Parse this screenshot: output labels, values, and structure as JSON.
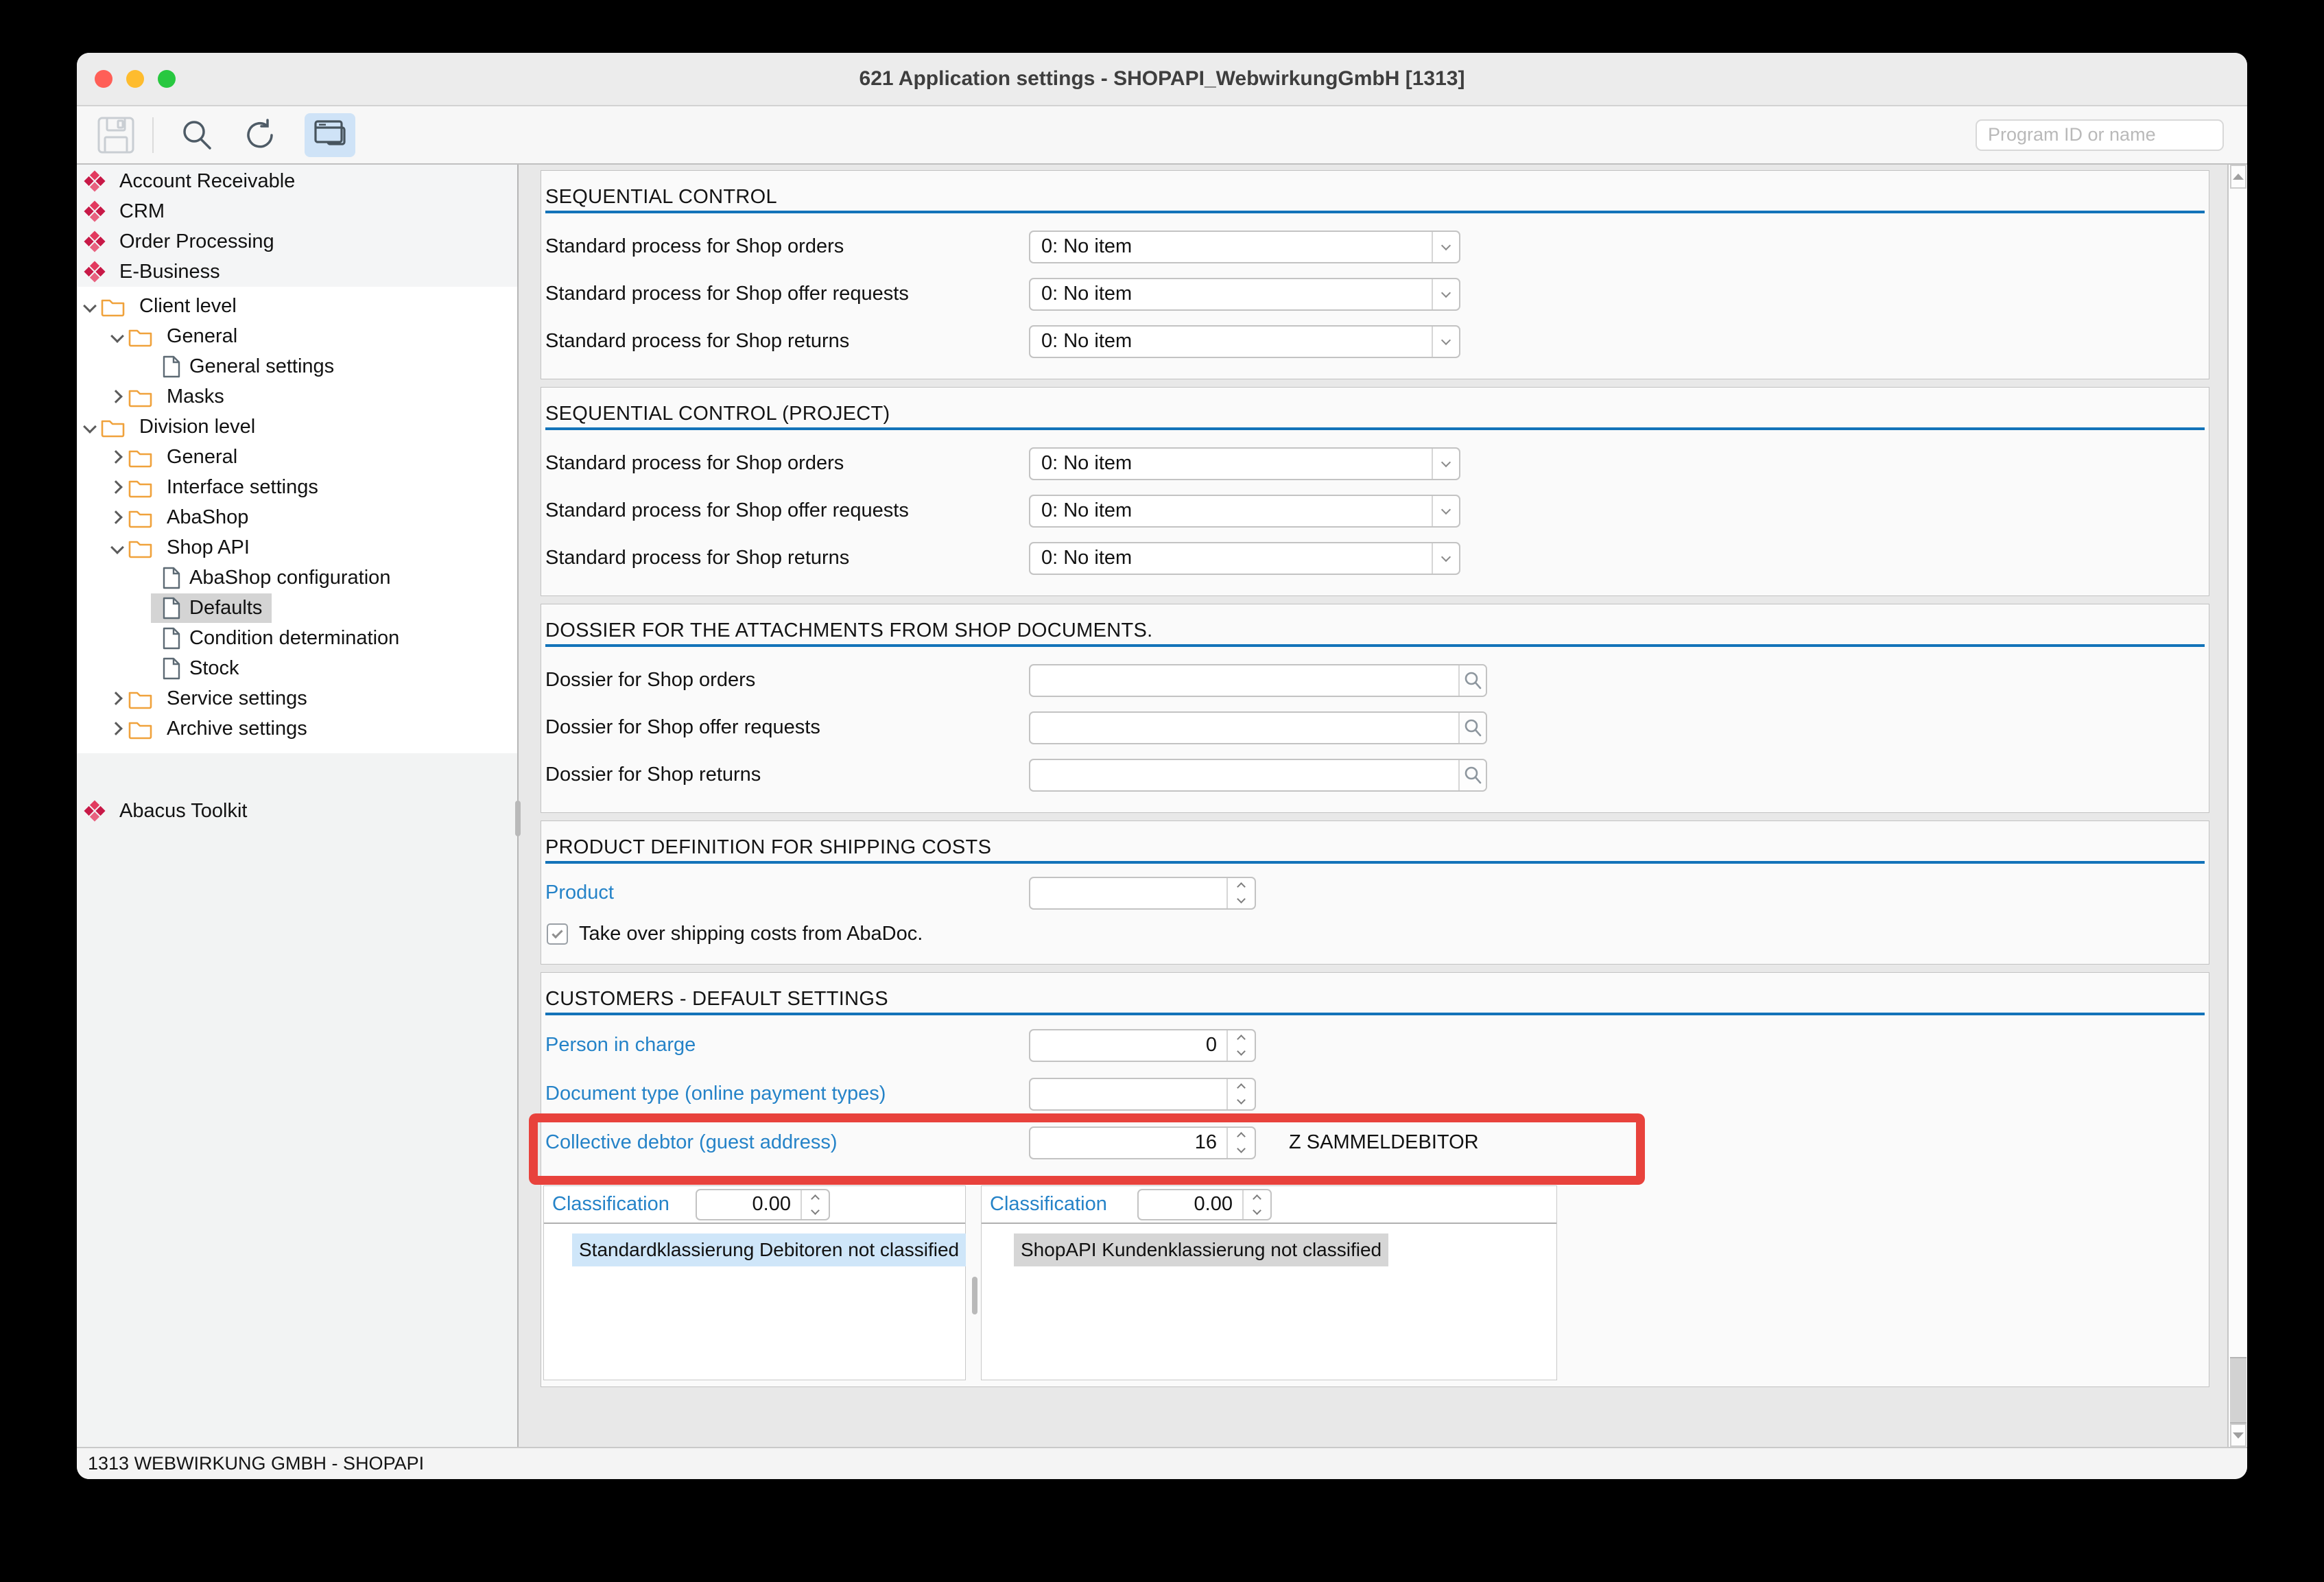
{
  "window": {
    "title": "621 Application settings - SHOPAPI_WebwirkungGmbH [1313]",
    "status_bar": "1313 WEBWIRKUNG GMBH - SHOPAPI"
  },
  "toolbar": {
    "search_placeholder": "Program ID or name",
    "icons": [
      "save-icon",
      "search-icon",
      "refresh-icon",
      "window-icon"
    ],
    "selected_icon": "window-icon",
    "selected_icon_bg": "#cfe3f7"
  },
  "sidebar": {
    "modules": [
      "Account Receivable",
      "CRM",
      "Order Processing",
      "E-Business"
    ],
    "tree": [
      {
        "label": "Client level",
        "level": 1,
        "type": "folder",
        "state": "expanded"
      },
      {
        "label": "General",
        "level": 2,
        "type": "folder",
        "state": "expanded"
      },
      {
        "label": "General settings",
        "level": 3,
        "type": "file"
      },
      {
        "label": "Masks",
        "level": 2,
        "type": "folder",
        "state": "collapsed"
      },
      {
        "label": "Division level",
        "level": 1,
        "type": "folder",
        "state": "expanded"
      },
      {
        "label": "General",
        "level": 2,
        "type": "folder",
        "state": "collapsed"
      },
      {
        "label": "Interface settings",
        "level": 2,
        "type": "folder",
        "state": "collapsed"
      },
      {
        "label": "AbaShop",
        "level": 2,
        "type": "folder",
        "state": "collapsed"
      },
      {
        "label": "Shop API",
        "level": 2,
        "type": "folder",
        "state": "expanded"
      },
      {
        "label": "AbaShop configuration",
        "level": 3,
        "type": "file"
      },
      {
        "label": "Defaults",
        "level": 3,
        "type": "file",
        "selected": true
      },
      {
        "label": "Condition determination",
        "level": 3,
        "type": "file"
      },
      {
        "label": "Stock",
        "level": 3,
        "type": "file"
      },
      {
        "label": "Service settings",
        "level": 2,
        "type": "folder",
        "state": "collapsed"
      },
      {
        "label": "Archive settings",
        "level": 2,
        "type": "folder",
        "state": "collapsed"
      }
    ],
    "toolkit": "Abacus Toolkit"
  },
  "panels": [
    {
      "title": "SEQUENTIAL CONTROL",
      "rows": [
        {
          "label": "Standard process for Shop orders",
          "control": "select",
          "value": "0: No item"
        },
        {
          "label": "Standard process for Shop offer requests",
          "control": "select",
          "value": "0: No item"
        },
        {
          "label": "Standard process for Shop returns",
          "control": "select",
          "value": "0: No item"
        }
      ]
    },
    {
      "title": "SEQUENTIAL CONTROL (PROJECT)",
      "rows": [
        {
          "label": "Standard process for Shop orders",
          "control": "select",
          "value": "0: No item"
        },
        {
          "label": "Standard process for Shop offer requests",
          "control": "select",
          "value": "0: No item"
        },
        {
          "label": "Standard process for Shop returns",
          "control": "select",
          "value": "0: No item"
        }
      ]
    },
    {
      "title": "DOSSIER FOR THE ATTACHMENTS FROM SHOP DOCUMENTS.",
      "rows": [
        {
          "label": "Dossier for Shop orders",
          "control": "search",
          "value": ""
        },
        {
          "label": "Dossier for Shop offer requests",
          "control": "search",
          "value": ""
        },
        {
          "label": "Dossier for Shop returns",
          "control": "search",
          "value": ""
        }
      ]
    },
    {
      "title": "PRODUCT DEFINITION FOR SHIPPING COSTS",
      "rows": [
        {
          "label": "Product",
          "blue": true,
          "control": "spinner",
          "value": ""
        }
      ],
      "checkbox": {
        "label": "Take over shipping costs from AbaDoc.",
        "checked": true
      }
    },
    {
      "title": "CUSTOMERS - DEFAULT SETTINGS",
      "rows": [
        {
          "label": "Person in charge",
          "blue": true,
          "control": "spinner",
          "value": "0"
        },
        {
          "label": "Document type (online payment types)",
          "blue": true,
          "control": "spinner",
          "value": ""
        },
        {
          "label": "Collective debtor (guest address)",
          "blue": true,
          "control": "spinner",
          "value": "16",
          "suffix": "Z SAMMELDEBITOR",
          "annotated": true
        }
      ],
      "classifications": [
        {
          "label": "Classification",
          "value": "0.00",
          "item": "Standardklassierung Debitoren not classified",
          "highlight": "blue"
        },
        {
          "label": "Classification",
          "value": "0.00",
          "item": "ShopAPI Kundenklassierung not classified",
          "highlight": "gray"
        }
      ]
    }
  ],
  "annotation": {
    "shape": "rectangle",
    "color": "#e8423c",
    "target": "Collective debtor (guest address) row"
  },
  "colors": {
    "section_rule": "#1373b9",
    "field_label_blue": "#2583c8",
    "folder_icon": "#f0a23c",
    "module_icon": "#d8275a",
    "selection_gray": "#d4d4d4",
    "highlight_blue": "#cfe6f9",
    "highlight_gray": "#d6d6d6"
  }
}
